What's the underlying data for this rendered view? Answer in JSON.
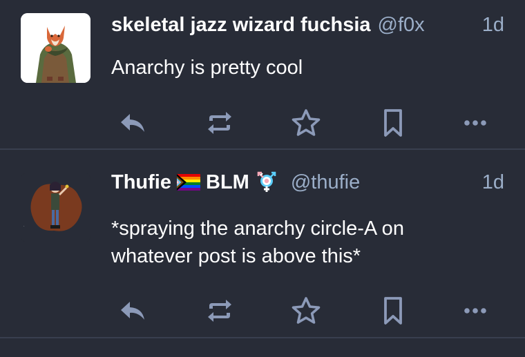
{
  "colors": {
    "background": "#282c37",
    "divider": "#393f4f",
    "muted": "#9baec8",
    "text": "#ffffff"
  },
  "posts": [
    {
      "display_name": "skeletal jazz wizard fuchsia",
      "handle": "@f0x",
      "timestamp": "1d",
      "content_lines": [
        "Anarchy is pretty cool"
      ],
      "avatar": "fox-in-cloak-illustration",
      "actions": [
        "reply-icon",
        "boost-icon",
        "favourite-star-icon",
        "bookmark-icon",
        "more-icon"
      ]
    },
    {
      "display_name_part1": "Thufie",
      "display_name_part2": "BLM",
      "flag_emoji": "progress-pride-flag",
      "symbol_emoji": "trans-symbol",
      "handle": "@thufie",
      "timestamp": "1d",
      "content_lines": [
        "*spraying the anarchy circle-A on",
        "whatever post is above this*"
      ],
      "avatar": "character-sketch-illustration",
      "actions": [
        "reply-icon",
        "boost-icon",
        "favourite-star-icon",
        "bookmark-icon",
        "more-icon"
      ]
    }
  ]
}
